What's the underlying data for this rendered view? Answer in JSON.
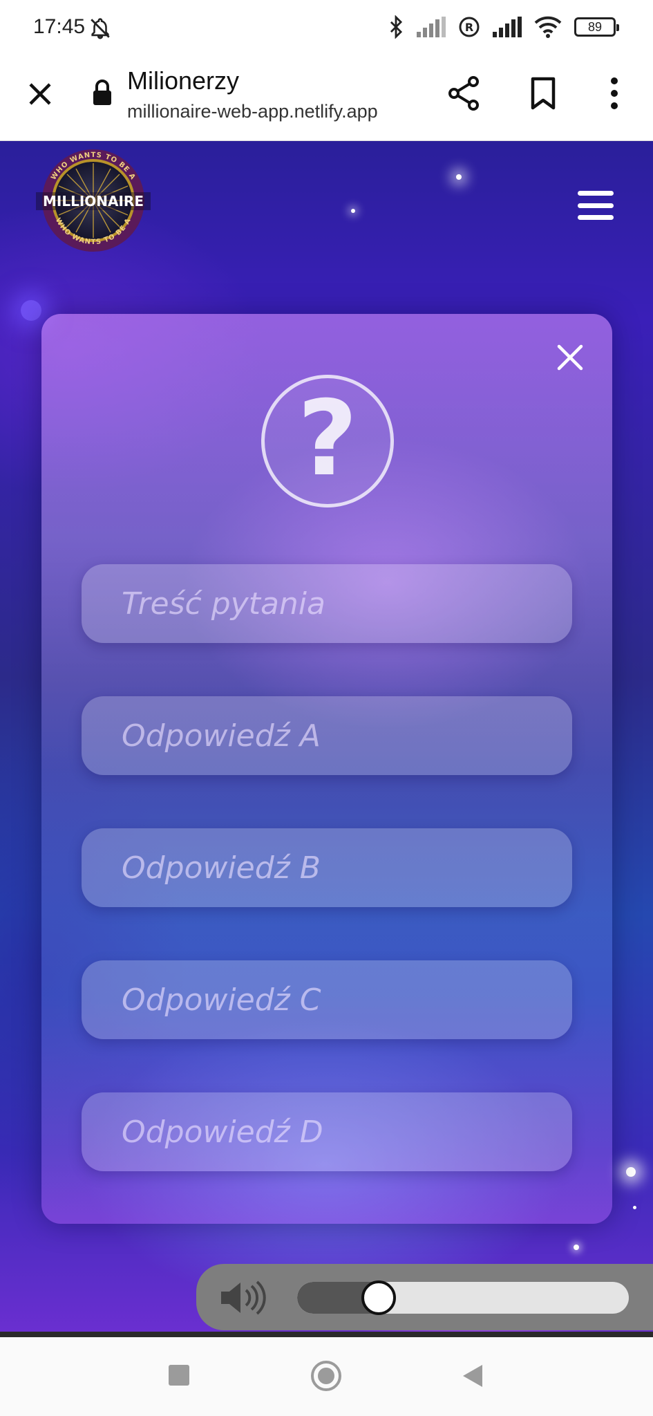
{
  "status_bar": {
    "time": "17:45",
    "battery": "89",
    "icons": [
      "bell-off-icon",
      "bluetooth-icon",
      "signal-icon",
      "registered-icon",
      "signal-icon",
      "wifi-icon",
      "battery-icon"
    ]
  },
  "browser": {
    "title": "Milionerzy",
    "url": "millionaire-web-app.netlify.app"
  },
  "logo": {
    "top_text": "WHO WANTS TO BE A",
    "main_text": "MILLIONAIRE",
    "bottom_text": "WHO WANTS TO BE A"
  },
  "form": {
    "question_placeholder": "Treść pytania",
    "answer_a_placeholder": "Odpowiedź A",
    "answer_b_placeholder": "Odpowiedź B",
    "answer_c_placeholder": "Odpowiedź C",
    "answer_d_placeholder": "Odpowiedź D"
  },
  "audio": {
    "volume": 0.2
  },
  "colors": {
    "accent": "#3a1fb8",
    "audio_bar": "#7e7e7e"
  }
}
